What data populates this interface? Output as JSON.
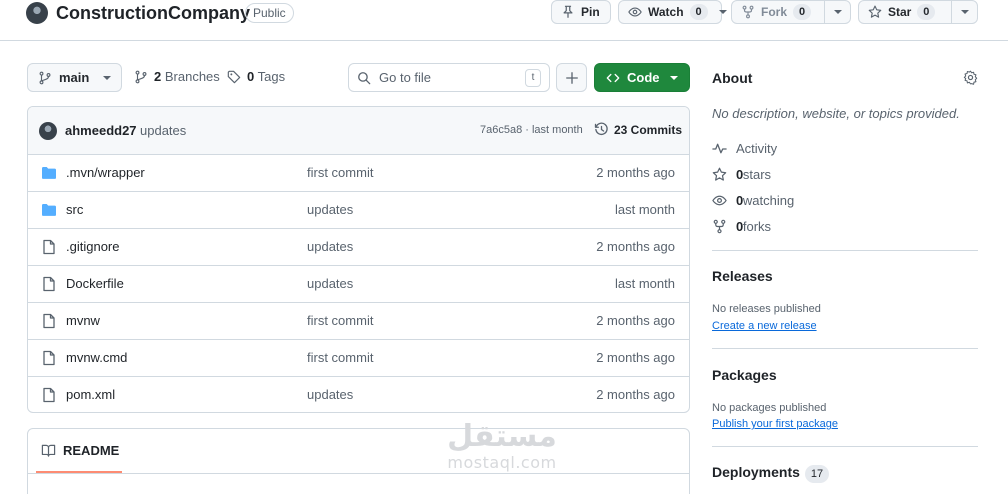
{
  "repo": {
    "name": "ConstructionCompany",
    "visibility": "Public",
    "actions": {
      "pin": "Pin",
      "watch": "Watch",
      "watch_count": "0",
      "fork": "Fork",
      "fork_count": "0",
      "star": "Star",
      "star_count": "0"
    }
  },
  "toolbar": {
    "branch": "main",
    "branches_count": "2",
    "branches_label": "Branches",
    "tags_count": "0",
    "tags_label": "Tags",
    "goto_placeholder": "Go to file",
    "goto_shortcut": "t",
    "code_label": "Code"
  },
  "latest_commit": {
    "author": "ahmeedd27",
    "message": "updates",
    "sha_time": "7a6c5a8 · last month",
    "commits_label": "23 Commits"
  },
  "files": [
    {
      "icon": "folder-icon",
      "name": ".mvn/wrapper",
      "message": "first commit",
      "date": "2 months ago"
    },
    {
      "icon": "folder-icon",
      "name": "src",
      "message": "updates",
      "date": "last month"
    },
    {
      "icon": "file-icon",
      "name": ".gitignore",
      "message": "updates",
      "date": "2 months ago"
    },
    {
      "icon": "file-icon",
      "name": "Dockerfile",
      "message": "updates",
      "date": "last month"
    },
    {
      "icon": "file-icon",
      "name": "mvnw",
      "message": "first commit",
      "date": "2 months ago"
    },
    {
      "icon": "file-icon",
      "name": "mvnw.cmd",
      "message": "first commit",
      "date": "2 months ago"
    },
    {
      "icon": "file-icon",
      "name": "pom.xml",
      "message": "updates",
      "date": "2 months ago"
    }
  ],
  "readme": {
    "tab_label": "README"
  },
  "sidebar": {
    "about": {
      "title": "About",
      "description": "No description, website, or topics provided.",
      "activity": "Activity",
      "stars_count": "0",
      "stars_label": "stars",
      "watching_count": "0",
      "watching_label": "watching",
      "forks_count": "0",
      "forks_label": "forks"
    },
    "releases": {
      "title": "Releases",
      "empty": "No releases published",
      "link": "Create a new release"
    },
    "packages": {
      "title": "Packages",
      "empty": "No packages published",
      "link": "Publish your first package"
    },
    "deployments": {
      "title": "Deployments",
      "count": "17"
    }
  },
  "watermark": {
    "arabic": "مستقل",
    "latin": "mostaql.com"
  },
  "colors": {
    "accent_green": "#1f883d",
    "link_blue": "#0969da",
    "folder_blue": "#54aeff",
    "border": "#d1d9e0",
    "muted_text": "#59636e"
  }
}
